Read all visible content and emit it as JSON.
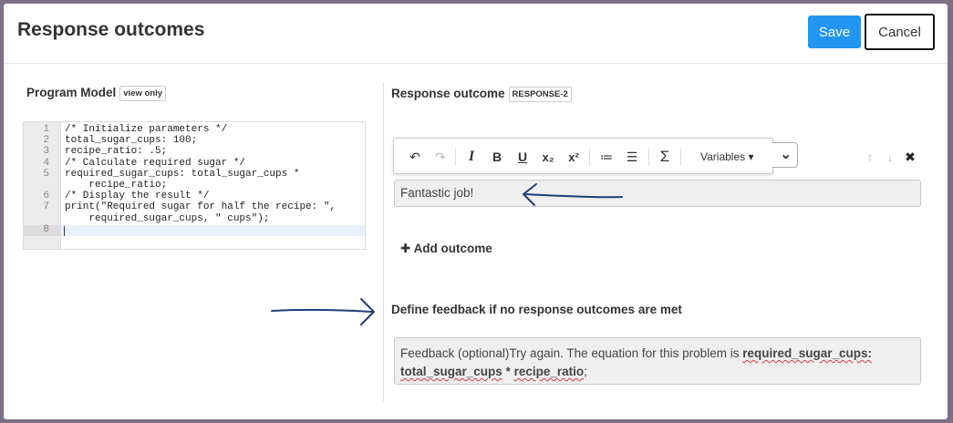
{
  "header": {
    "title": "Response outcomes",
    "save_label": "Save",
    "cancel_label": "Cancel"
  },
  "program_model": {
    "label": "Program Model",
    "tag": "view only",
    "lines": [
      {
        "num": "1",
        "text": "/* Initialize parameters */"
      },
      {
        "num": "2",
        "text": "total_sugar_cups: 100;"
      },
      {
        "num": "3",
        "text": "recipe_ratio: .5;"
      },
      {
        "num": "4",
        "text": "/* Calculate required sugar */"
      },
      {
        "num": "5",
        "text": "required_sugar_cups: total_sugar_cups *"
      },
      {
        "num": "",
        "text": "    recipe_ratio;"
      },
      {
        "num": "6",
        "text": "/* Display the result */"
      },
      {
        "num": "7",
        "text": "print(\"Required sugar for half the recipe: \","
      },
      {
        "num": "",
        "text": "    required_sugar_cups, \" cups\");"
      },
      {
        "num": "8",
        "text": ""
      }
    ]
  },
  "response_outcome": {
    "label": "Response outcome",
    "tag": "RESPONSE-2",
    "toolbar": {
      "undo": "↶",
      "redo": "↷",
      "italic": "I",
      "bold": "B",
      "underline": "U",
      "subscript": "x₂",
      "superscript": "x²",
      "ordered_list": "≔",
      "bullet_list": "☰",
      "sum": "Σ",
      "variables_label": "Variables ▾"
    },
    "icons": {
      "select_chevron": "⌄",
      "move_up": "↑",
      "move_down": "↓",
      "delete": "✖"
    },
    "outcome_text": "Fantastic job!",
    "add_outcome_label": "Add outcome",
    "add_icon": "✚"
  },
  "default_feedback": {
    "label": "Define feedback if no response outcomes are met",
    "text_prefix": "Feedback (optional)Try again. The equation for this problem is ",
    "bold1": "required_sugar_cups:",
    "bold2": "total_sugar_cups",
    "mid": " * ",
    "bold3": "recipe_ratio",
    "end": ";"
  },
  "colors": {
    "primary": "#2196f3",
    "annotation_arrow": "#1f3f7a"
  }
}
